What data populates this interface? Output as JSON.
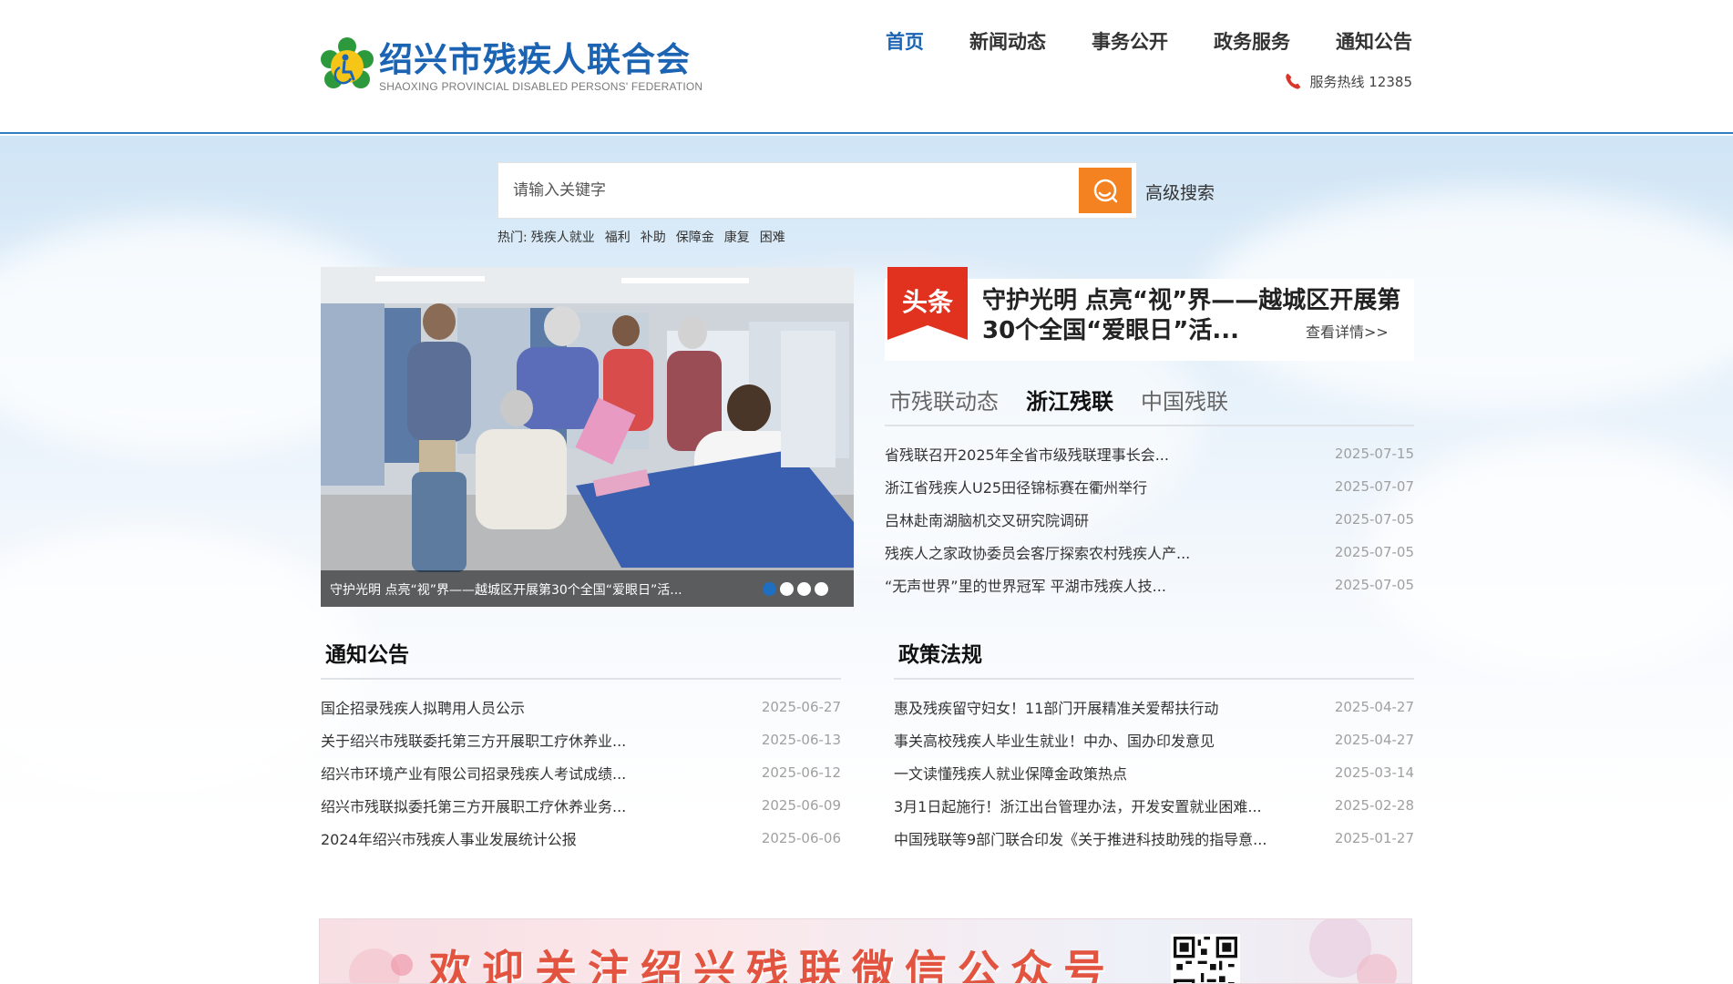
{
  "site": {
    "title": "绍兴市残疾人联合会",
    "subtitle": "SHAOXING PROVINCIAL DISABLED PERSONS' FEDERATION",
    "brand_color": "#1b64b4",
    "accent_color": "#f58220"
  },
  "nav": {
    "items": [
      {
        "label": "首页",
        "active": true
      },
      {
        "label": "新闻动态",
        "active": false
      },
      {
        "label": "事务公开",
        "active": false
      },
      {
        "label": "政务服务",
        "active": false
      },
      {
        "label": "通知公告",
        "active": false
      }
    ]
  },
  "hotline": {
    "icon": "phone-icon",
    "label": "服务热线 12385"
  },
  "search": {
    "placeholder": "请输入关键字",
    "button_icon": "search-icon",
    "advanced_label": "高级搜索",
    "hot_label": "热门:",
    "hot_words": [
      "残疾人就业",
      "福利",
      "补助",
      "保障金",
      "康复",
      "困难"
    ]
  },
  "carousel": {
    "caption": "守护光明 点亮“视”界——越城区开展第30个全国“爱眼日”活...",
    "dot_count": 4,
    "active_dot": 0
  },
  "headline": {
    "badge": "头条",
    "title": "守护光明 点亮“视”界——越城区开展第30个全国“爱眼日”活...",
    "more": "查看详情>>"
  },
  "news_tabs": {
    "tabs": [
      {
        "label": "市残联动态",
        "active": false
      },
      {
        "label": "浙江残联",
        "active": true
      },
      {
        "label": "中国残联",
        "active": false
      }
    ],
    "items": [
      {
        "title": "省残联召开2025年全省市级残联理事长会...",
        "date": "2025-07-15"
      },
      {
        "title": "浙江省残疾人U25田径锦标赛在衢州举行",
        "date": "2025-07-07"
      },
      {
        "title": "吕林赴南湖脑机交叉研究院调研",
        "date": "2025-07-05"
      },
      {
        "title": "残疾人之家政协委员会客厅探索农村残疾人产...",
        "date": "2025-07-05"
      },
      {
        "title": "“无声世界”里的世界冠军 平湖市残疾人技...",
        "date": "2025-07-05"
      }
    ]
  },
  "notices": {
    "heading": "通知公告",
    "items": [
      {
        "title": "国企招录残疾人拟聘用人员公示",
        "date": "2025-06-27"
      },
      {
        "title": "关于绍兴市残联委托第三方开展职工疗休养业...",
        "date": "2025-06-13"
      },
      {
        "title": "绍兴市环境产业有限公司招录残疾人考试成绩...",
        "date": "2025-06-12"
      },
      {
        "title": "绍兴市残联拟委托第三方开展职工疗休养业务...",
        "date": "2025-06-09"
      },
      {
        "title": "2024年绍兴市残疾人事业发展统计公报",
        "date": "2025-06-06"
      }
    ]
  },
  "policies": {
    "heading": "政策法规",
    "items": [
      {
        "title": "惠及残疾留守妇女！11部门开展精准关爱帮扶行动",
        "date": "2025-04-27"
      },
      {
        "title": "事关高校残疾人毕业生就业！中办、国办印发意见",
        "date": "2025-04-27"
      },
      {
        "title": "一文读懂残疾人就业保障金政策热点",
        "date": "2025-03-14"
      },
      {
        "title": "3月1日起施行！浙江出台管理办法，开发安置就业困难...",
        "date": "2025-02-28"
      },
      {
        "title": "中国残联等9部门联合印发《关于推进科技助残的指导意...",
        "date": "2025-01-27"
      }
    ]
  },
  "wechat_banner": {
    "text": "欢迎关注绍兴残联微信公众号",
    "qr_icon": "qr-code-icon"
  }
}
